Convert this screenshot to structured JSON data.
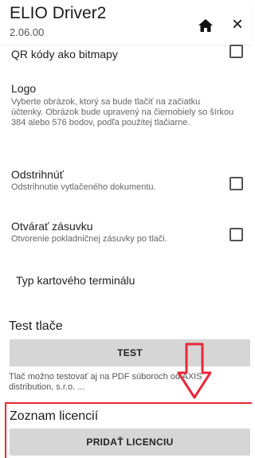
{
  "header": {
    "title": "ELIO Driver2",
    "version": "2.06.00"
  },
  "settings": {
    "qr": {
      "label": "QR kódy ako bitmapy",
      "checked": false
    },
    "logo": {
      "title": "Logo",
      "description": "Vyberte obrázok, ktorý sa bude tlačiť na začiatku účtenky. Obrázok bude upravený na čiernobiely so šírkou 384 alebo 576 bodov, podľa použitej tlačiarne."
    },
    "tear": {
      "title": "Odstrihnúť",
      "description": "Odstrihnutie vytlačeného dokumentu.",
      "checked": false
    },
    "drawer": {
      "title": "Otvárať zásuvku",
      "description": "Otvorenie pokladničnej zásuvky po tlači.",
      "checked": false
    },
    "terminal": {
      "title": "Typ kartového terminálu"
    }
  },
  "test_section": {
    "title": "Test tlače",
    "button_label": "TEST",
    "note": "Tlač možno testovať aj na PDF súboroch od AXIS distribution, s.r.o. ..."
  },
  "license_section": {
    "title": "Zoznam licencií",
    "button_label": "PRIDAŤ LICENCIU"
  },
  "colors": {
    "highlight": "#e8283a",
    "button_bg": "#d6d6d6"
  },
  "icons": [
    "home-icon",
    "close-icon",
    "down-arrow-annotation"
  ]
}
